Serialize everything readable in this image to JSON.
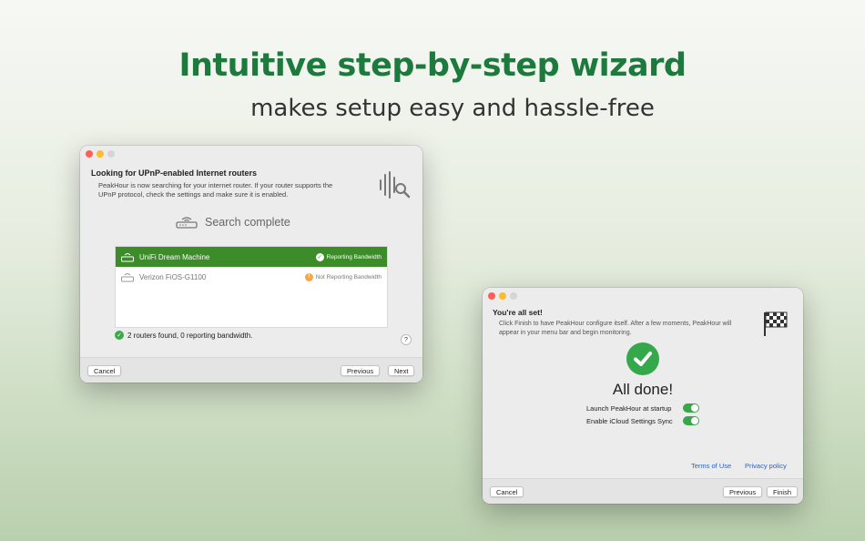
{
  "headline": "Intuitive step-by-step wizard",
  "subheadline": "makes setup easy and hassle-free",
  "wizard1": {
    "title": "Looking for UPnP-enabled Internet routers",
    "description_line1": "PeakHour is now searching for your internet router. If your router supports the",
    "description_line2": "UPnP protocol, check the settings and make sure it is enabled.",
    "search_status": "Search complete",
    "routers": [
      {
        "name": "UniFi Dream Machine",
        "status": "Reporting Bandwidth"
      },
      {
        "name": "Verizon FiOS-G1100",
        "status": "Not Reporting Bandwidth"
      }
    ],
    "summary": "2 routers found, 0 reporting bandwidth.",
    "help_label": "?",
    "cancel_label": "Cancel",
    "previous_label": "Previous",
    "next_label": "Next"
  },
  "wizard2": {
    "title": "You're all set!",
    "description_line1": "Click Finish to have PeakHour configure itself. After a few moments, PeakHour will",
    "description_line2": "appear in your menu bar and begin monitoring.",
    "done_text": "All done!",
    "options": [
      {
        "label": "Launch PeakHour at startup",
        "enabled": true
      },
      {
        "label": "Enable iCloud Settings Sync",
        "enabled": true
      }
    ],
    "terms_label": "Terms of Use",
    "privacy_label": "Privacy policy",
    "cancel_label": "Cancel",
    "previous_label": "Previous",
    "finish_label": "Finish"
  },
  "colors": {
    "headline": "#1c7a3c",
    "selected_row": "#3c8c2a",
    "check_green": "#34a84a",
    "link_blue": "#2a63c7"
  }
}
